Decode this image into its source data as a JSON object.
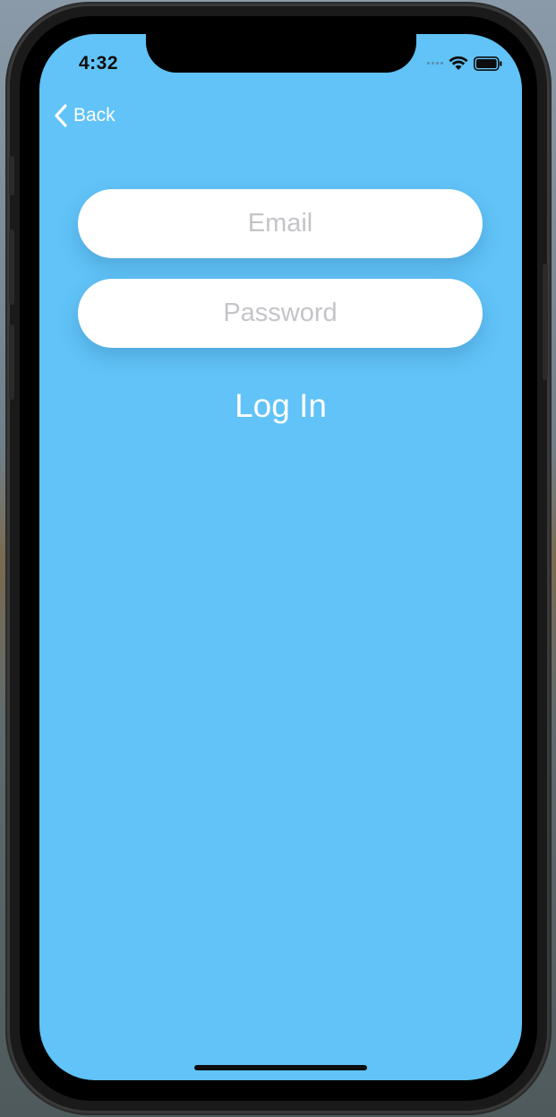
{
  "status_bar": {
    "time": "4:32"
  },
  "nav": {
    "back_label": "Back"
  },
  "form": {
    "email_placeholder": "Email",
    "email_value": "",
    "password_placeholder": "Password",
    "password_value": "",
    "login_label": "Log In"
  },
  "colors": {
    "screen_background": "#61c3f7",
    "field_background": "#ffffff",
    "placeholder_text": "#c4c4c9",
    "accent_text": "#ffffff"
  },
  "icons": {
    "back": "chevron-left-icon",
    "cellular": "cellular-signal-icon",
    "wifi": "wifi-icon",
    "battery": "battery-icon"
  }
}
